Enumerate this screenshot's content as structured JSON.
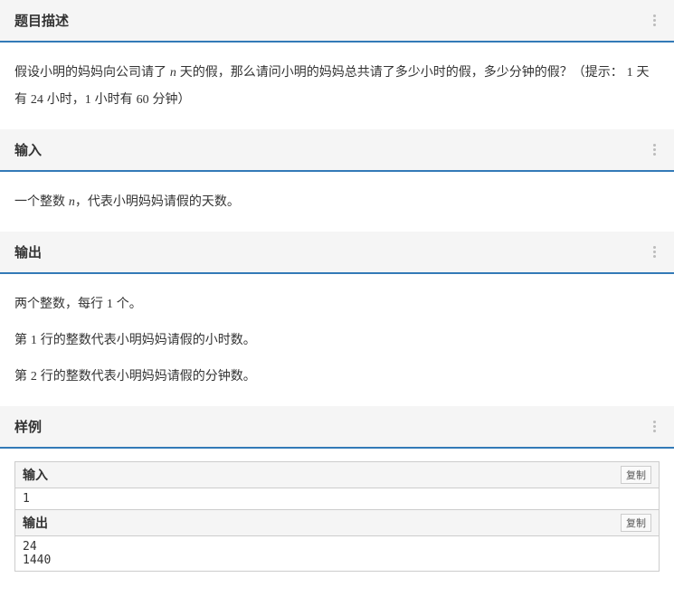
{
  "sections": {
    "description": {
      "title": "题目描述",
      "body_html": "假设小明的妈妈向公司请了 <span class='mvar'>n</span> 天的假，那么请问小明的妈妈总共请了多少小时的假，多少分钟的假？（提示： <span class='mnum'>1</span> 天有 <span class='mnum'>24</span> 小时，<span class='mnum'>1</span> 小时有 <span class='mnum'>60</span> 分钟）"
    },
    "input": {
      "title": "输入",
      "body_html": "一个整数 <span class='mvar'>n</span>，代表小明妈妈请假的天数。"
    },
    "output": {
      "title": "输出",
      "lines": [
        "两个整数，每行 <span class='mnum'>1</span> 个。",
        "第 <span class='mnum'>1</span> 行的整数代表小明妈妈请假的小时数。",
        "第 <span class='mnum'>2</span> 行的整数代表小明妈妈请假的分钟数。"
      ]
    },
    "sample": {
      "title": "样例",
      "input_label": "输入",
      "output_label": "输出",
      "copy_label": "复制",
      "input_data": "1",
      "output_data": "24\n1440"
    }
  }
}
